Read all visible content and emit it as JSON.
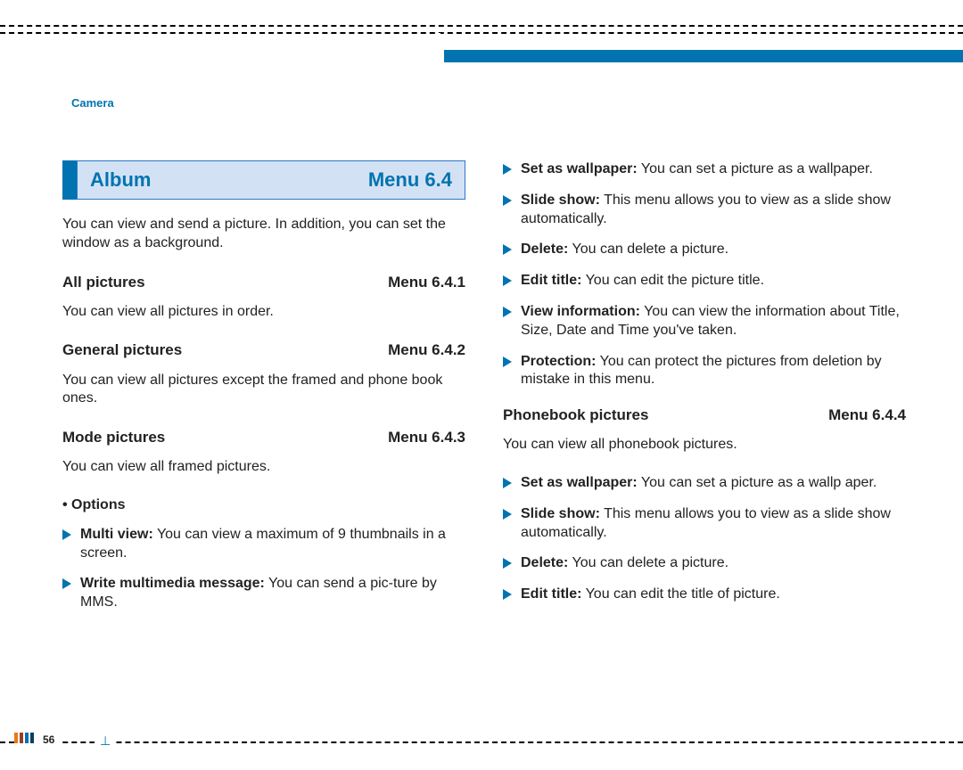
{
  "section_label": "Camera",
  "album": {
    "title": "Album",
    "menu": "Menu 6.4",
    "intro": "You can view and send a picture. In addition, you can set the window as a background."
  },
  "subsections": {
    "all_pictures": {
      "title": "All pictures",
      "menu": "Menu 6.4.1",
      "desc": "You can view all pictures in order."
    },
    "general_pictures": {
      "title": "General pictures",
      "menu": "Menu 6.4.2",
      "desc": "You can view all pictures except the framed and phone book ones."
    },
    "mode_pictures": {
      "title": "Mode pictures",
      "menu": "Menu 6.4.3",
      "desc": "You can view all framed pictures."
    },
    "phonebook_pictures": {
      "title": "Phonebook pictures",
      "menu": "Menu 6.4.4",
      "desc": "You can view all phonebook pictures."
    }
  },
  "options_label": "• Options",
  "mode_options": {
    "multi_view": {
      "label": "Multi view:",
      "text": " You can view a maximum of 9 thumbnails in a screen."
    },
    "write_mms": {
      "label": "Write multimedia message:",
      "text": " You can send a pic-ture by MMS."
    },
    "set_wallpaper": {
      "label": "Set as wallpaper:",
      "text": " You can set a picture as a wallpaper."
    },
    "slide_show": {
      "label": "Slide show:",
      "text": " This menu allows you to view as a slide show automatically."
    },
    "delete": {
      "label": "Delete:",
      "text": " You can delete a picture."
    },
    "edit_title": {
      "label": "Edit title:",
      "text": " You can edit the picture title."
    },
    "view_info": {
      "label": "View information:",
      "text": " You can view the information about Title, Size, Date and Time you've taken."
    },
    "protection": {
      "label": "Protection:",
      "text": " You can protect the pictures from deletion by mistake in this menu."
    }
  },
  "phonebook_options": {
    "set_wallpaper": {
      "label": "Set as wallpaper:",
      "text": " You can set a picture as a wallp aper."
    },
    "slide_show": {
      "label": "Slide show:",
      "text": " This menu allows you to view as a slide show automatically."
    },
    "delete": {
      "label": "Delete:",
      "text": " You can delete a picture."
    },
    "edit_title": {
      "label": "Edit title:",
      "text": " You can edit the title of picture."
    }
  },
  "page_number": "56"
}
